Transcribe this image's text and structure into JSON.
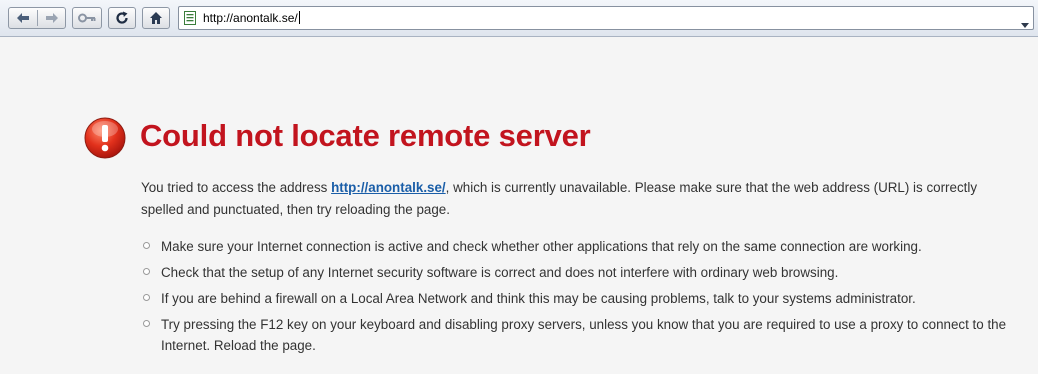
{
  "browser": {
    "url": "http://anontalk.se/"
  },
  "error": {
    "title": "Could not locate remote server",
    "description_pre": "You tried to access the address ",
    "link_text": "http://anontalk.se/",
    "description_post": ", which is currently unavailable. Please make sure that the web address (URL) is correctly spelled and punctuated, then try reloading the page.",
    "tips": [
      "Make sure your Internet connection is active and check whether other applications that rely on the same connection are working.",
      "Check that the setup of any Internet security software is correct and does not interfere with ordinary web browsing.",
      "If you are behind a firewall on a Local Area Network and think this may be causing problems, talk to your systems administrator.",
      "Try pressing the F12 key on your keyboard and disabling proxy servers, unless you know that you are required to use a proxy to connect to the Internet. Reload the page."
    ]
  },
  "colors": {
    "title": "#c2141e",
    "link": "#1a5ea8",
    "text": "#333333",
    "background": "#f5f5f5"
  },
  "icons": {
    "back": "back-arrow-icon",
    "forward": "forward-arrow-icon",
    "key": "key-icon",
    "reload": "reload-icon",
    "home": "home-icon",
    "page": "page-icon",
    "dropdown": "chevron-down-icon",
    "alert": "exclamation-icon"
  }
}
